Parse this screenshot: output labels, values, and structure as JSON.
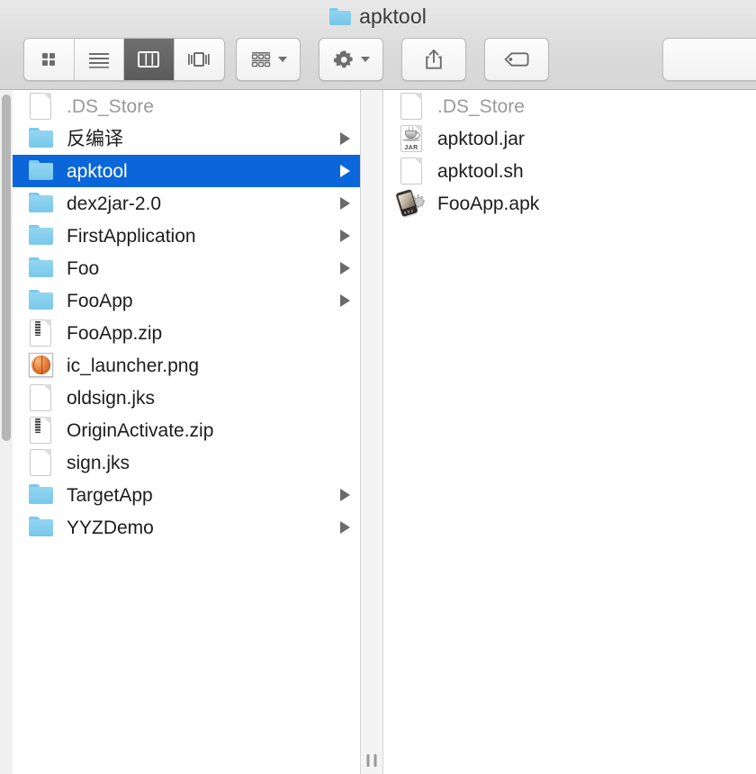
{
  "window": {
    "title": "apktool",
    "title_icon": "folder-icon"
  },
  "toolbar": {
    "view_modes": [
      {
        "id": "icon-view",
        "icon": "grid-icon",
        "selected": false
      },
      {
        "id": "list-view",
        "icon": "list-lines-icon",
        "selected": false
      },
      {
        "id": "column-view",
        "icon": "columns-icon",
        "selected": true
      },
      {
        "id": "gallery-view",
        "icon": "gallery-icon",
        "selected": false
      }
    ],
    "buttons": [
      {
        "id": "arrange",
        "icon": "group-grid-icon",
        "has_menu": true
      },
      {
        "id": "action",
        "icon": "gear-icon",
        "has_menu": true
      },
      {
        "id": "share",
        "icon": "share-icon",
        "has_menu": false
      },
      {
        "id": "tags",
        "icon": "tag-icon",
        "has_menu": false
      }
    ],
    "search": {
      "value": "",
      "placeholder": ""
    }
  },
  "columns": [
    {
      "id": "column-parent",
      "items": [
        {
          "name": ".DS_Store",
          "icon": "document-icon",
          "kind": "doc",
          "dimmed": true,
          "expandable": false,
          "selected": false
        },
        {
          "name": "反编译",
          "icon": "folder-icon",
          "kind": "folder",
          "dimmed": false,
          "expandable": true,
          "selected": false
        },
        {
          "name": "apktool",
          "icon": "folder-icon",
          "kind": "folder",
          "dimmed": false,
          "expandable": true,
          "selected": true
        },
        {
          "name": "dex2jar-2.0",
          "icon": "folder-icon",
          "kind": "folder",
          "dimmed": false,
          "expandable": true,
          "selected": false
        },
        {
          "name": "FirstApplication",
          "icon": "folder-icon",
          "kind": "folder",
          "dimmed": false,
          "expandable": true,
          "selected": false
        },
        {
          "name": "Foo",
          "icon": "folder-icon",
          "kind": "folder",
          "dimmed": false,
          "expandable": true,
          "selected": false
        },
        {
          "name": "FooApp",
          "icon": "folder-icon",
          "kind": "folder",
          "dimmed": false,
          "expandable": true,
          "selected": false
        },
        {
          "name": "FooApp.zip",
          "icon": "zip-icon",
          "kind": "zip",
          "dimmed": false,
          "expandable": false,
          "selected": false
        },
        {
          "name": "ic_launcher.png",
          "icon": "image-icon",
          "kind": "png",
          "dimmed": false,
          "expandable": false,
          "selected": false
        },
        {
          "name": "oldsign.jks",
          "icon": "document-icon",
          "kind": "doc",
          "dimmed": false,
          "expandable": false,
          "selected": false
        },
        {
          "name": "OriginActivate.zip",
          "icon": "zip-icon",
          "kind": "zip",
          "dimmed": false,
          "expandable": false,
          "selected": false
        },
        {
          "name": "sign.jks",
          "icon": "document-icon",
          "kind": "doc",
          "dimmed": false,
          "expandable": false,
          "selected": false
        },
        {
          "name": "TargetApp",
          "icon": "folder-icon",
          "kind": "folder",
          "dimmed": false,
          "expandable": true,
          "selected": false
        },
        {
          "name": "YYZDemo",
          "icon": "folder-icon",
          "kind": "folder",
          "dimmed": false,
          "expandable": true,
          "selected": false
        }
      ]
    },
    {
      "id": "column-apktool",
      "items": [
        {
          "name": ".DS_Store",
          "icon": "document-icon",
          "kind": "doc",
          "dimmed": true,
          "expandable": false,
          "selected": false
        },
        {
          "name": "apktool.jar",
          "icon": "java-jar-icon",
          "kind": "jar",
          "dimmed": false,
          "expandable": false,
          "selected": false
        },
        {
          "name": "apktool.sh",
          "icon": "document-icon",
          "kind": "doc",
          "dimmed": false,
          "expandable": false,
          "selected": false
        },
        {
          "name": "FooApp.apk",
          "icon": "android-apk-icon",
          "kind": "apk",
          "dimmed": false,
          "expandable": false,
          "selected": false
        }
      ]
    }
  ],
  "colors": {
    "selection_blue": "#0b67d9",
    "folder_blue": "#79c8ea",
    "dimmed_text": "#9a9a9a",
    "text": "#1d1d1d",
    "chrome_top": "#e9e9e9",
    "chrome_bottom": "#d6d6d6"
  },
  "scrollbar": {
    "visible": true,
    "thumb_top_pct": 0,
    "thumb_height_pct": 51
  }
}
